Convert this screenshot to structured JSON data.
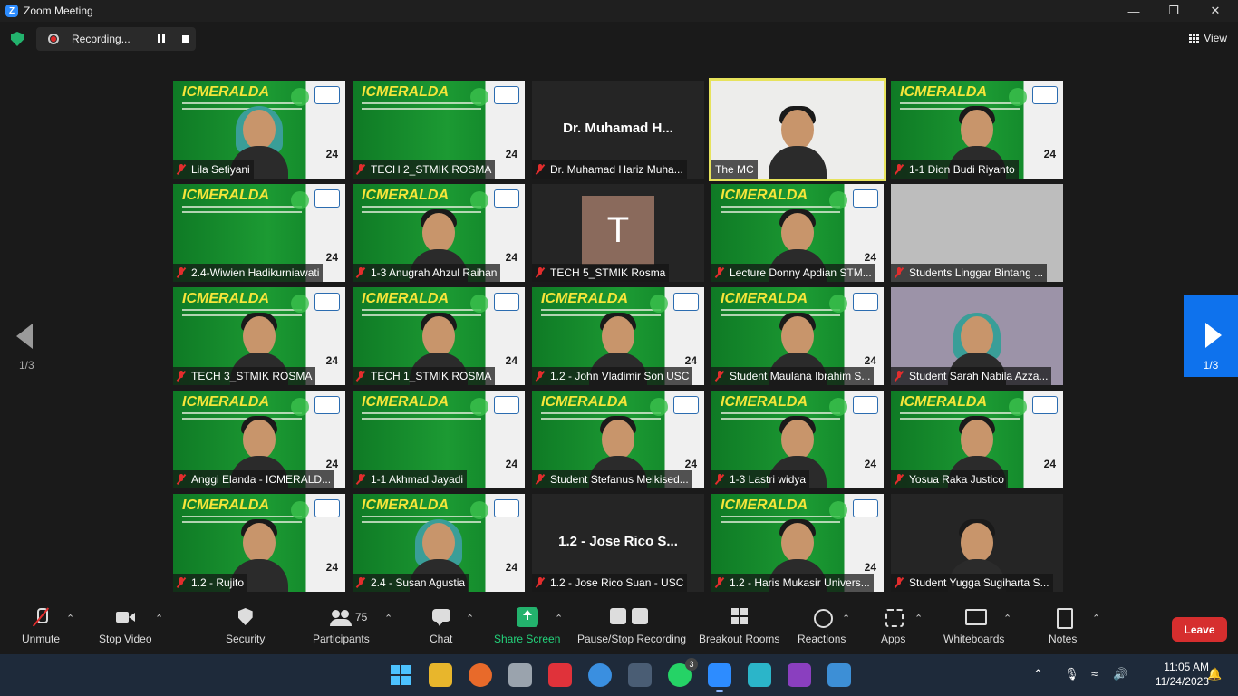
{
  "window": {
    "title": "Zoom Meeting"
  },
  "recording": {
    "label": "Recording..."
  },
  "view": {
    "label": "View"
  },
  "pager": {
    "left": "1/3",
    "right": "1/3"
  },
  "tiles": [
    {
      "name": "Lila Setiyani",
      "bg": "green",
      "person": "hijab"
    },
    {
      "name": "TECH 2_STMIK ROSMA",
      "bg": "green",
      "person": ""
    },
    {
      "name": "Dr. Muhamad Hariz Muha...",
      "bg": "dark",
      "big": "Dr. Muhamad H..."
    },
    {
      "name": "The MC",
      "bg": "white",
      "person": "man",
      "active": true,
      "nomic": true
    },
    {
      "name": "1-1 Dion Budi Riyanto",
      "bg": "green",
      "person": "man"
    },
    {
      "name": "2.4-Wiwien Hadikurniawati",
      "bg": "green",
      "person": ""
    },
    {
      "name": "1-3 Anugrah Ahzul Raihan",
      "bg": "green",
      "person": "man"
    },
    {
      "name": "TECH 5_STMIK Rosma",
      "bg": "dark",
      "avatar": "T"
    },
    {
      "name": "Lecture Donny Apdian STM...",
      "bg": "green",
      "person": "man"
    },
    {
      "name": "Students Linggar Bintang ...",
      "bg": "gray",
      "person": ""
    },
    {
      "name": "TECH 3_STMIK ROSMA",
      "bg": "green",
      "person": "man"
    },
    {
      "name": "TECH 1_STMIK ROSMA",
      "bg": "green",
      "person": "man"
    },
    {
      "name": "1.2 - John Vladimir Son USC",
      "bg": "green",
      "person": "man"
    },
    {
      "name": "Student Maulana Ibrahim S...",
      "bg": "green",
      "person": "man"
    },
    {
      "name": "Student Sarah Nabila Azza...",
      "bg": "lav",
      "person": "hijab"
    },
    {
      "name": "Anggi Elanda - ICMERALD...",
      "bg": "green",
      "person": "man"
    },
    {
      "name": "1-1 Akhmad Jayadi",
      "bg": "green",
      "person": ""
    },
    {
      "name": "Student Stefanus Melkised...",
      "bg": "green",
      "person": "man"
    },
    {
      "name": "1-3 Lastri widya",
      "bg": "green",
      "person": "man"
    },
    {
      "name": "Yosua Raka Justico",
      "bg": "green",
      "person": "man"
    },
    {
      "name": "1.2 - Rujito",
      "bg": "green",
      "person": "man"
    },
    {
      "name": "2.4 - Susan Agustia",
      "bg": "green",
      "person": "hijab"
    },
    {
      "name": "1.2 - Jose Rico Suan - USC",
      "bg": "dark",
      "big": "1.2 - Jose Rico S..."
    },
    {
      "name": "1.2 - Haris Mukasir Univers...",
      "bg": "green",
      "person": "man"
    },
    {
      "name": "Student Yugga Sugiharta S...",
      "bg": "dark",
      "person": "man"
    }
  ],
  "brand": {
    "text": "ICMERALDA",
    "num": "24"
  },
  "toolbar": {
    "unmute": "Unmute",
    "stop_video": "Stop Video",
    "security": "Security",
    "participants": "Participants",
    "participants_count": "75",
    "chat": "Chat",
    "share_screen": "Share Screen",
    "pause_stop": "Pause/Stop Recording",
    "breakout": "Breakout Rooms",
    "reactions": "Reactions",
    "apps": "Apps",
    "whiteboards": "Whiteboards",
    "notes": "Notes",
    "leave": "Leave"
  },
  "taskbar": {
    "time": "11:05 AM",
    "date": "11/24/2023",
    "whatsapp_badge": "3"
  }
}
